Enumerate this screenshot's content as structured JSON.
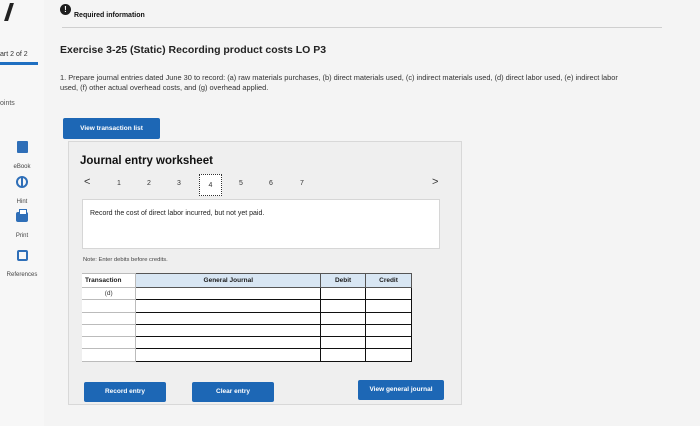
{
  "header": {
    "alert_glyph": "!",
    "required_label": "Required information"
  },
  "rail": {
    "part_label": "art 2 of 2",
    "points_label": "oints",
    "items": [
      {
        "label": "eBook",
        "icon": "book-icon"
      },
      {
        "label": "Hint",
        "icon": "hint-icon"
      },
      {
        "label": "Print",
        "icon": "print-icon"
      },
      {
        "label": "References",
        "icon": "references-icon"
      }
    ]
  },
  "exercise": {
    "title": "Exercise 3-25 (Static) Recording product costs LO P3",
    "instructions": "1. Prepare journal entries dated June 30 to record: (a) raw materials purchases, (b) direct materials used, (c) indirect materials used, (d) direct labor used, (e) indirect labor used, (f) other actual overhead costs, and (g) overhead applied."
  },
  "buttons": {
    "view_transaction_list": "View transaction list",
    "record_entry": "Record entry",
    "clear_entry": "Clear entry",
    "view_general_journal": "View general journal"
  },
  "worksheet": {
    "title": "Journal entry worksheet",
    "prev_glyph": "<",
    "next_glyph": ">",
    "pages": [
      "1",
      "2",
      "3",
      "4",
      "5",
      "6",
      "7"
    ],
    "active_page": "4",
    "prompt": "Record the cost of direct labor incurred, but not yet paid.",
    "note": "Note: Enter debits before credits."
  },
  "table": {
    "headers": {
      "transaction": "Transaction",
      "general_journal": "General Journal",
      "debit": "Debit",
      "credit": "Credit"
    },
    "rows": [
      {
        "transaction": "(d)",
        "account": "",
        "debit": "",
        "credit": ""
      },
      {
        "transaction": "",
        "account": "",
        "debit": "",
        "credit": ""
      },
      {
        "transaction": "",
        "account": "",
        "debit": "",
        "credit": ""
      },
      {
        "transaction": "",
        "account": "",
        "debit": "",
        "credit": ""
      },
      {
        "transaction": "",
        "account": "",
        "debit": "",
        "credit": ""
      },
      {
        "transaction": "",
        "account": "",
        "debit": "",
        "credit": ""
      }
    ]
  },
  "colors": {
    "accent": "#1d67b5",
    "table_header": "#d8e6f3"
  }
}
